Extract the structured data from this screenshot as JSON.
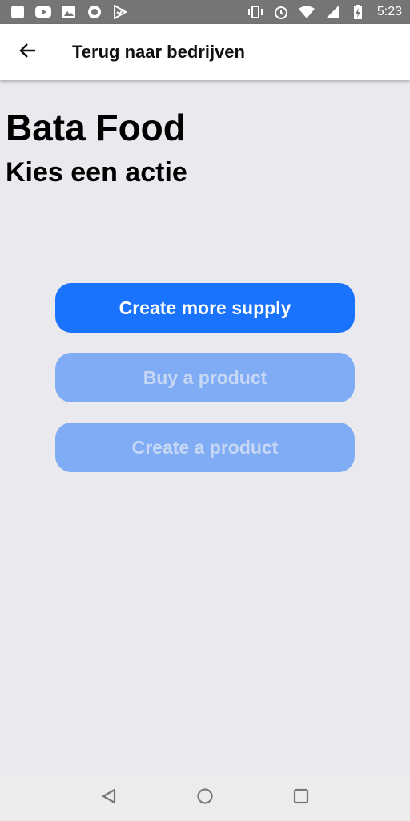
{
  "status_bar": {
    "time": "5:23",
    "left_icons": [
      "app-icon",
      "youtube-icon",
      "image-icon",
      "record-icon",
      "check-icon"
    ],
    "right_icons": [
      "vibrate-icon",
      "alarm-icon",
      "wifi-icon",
      "signal-icon",
      "battery-icon"
    ]
  },
  "app_bar": {
    "back_icon": "arrow-left-icon",
    "title": "Terug naar bedrijven"
  },
  "main": {
    "company_name": "Bata Food",
    "subtitle": "Kies een actie",
    "actions": [
      {
        "label": "Create more supply",
        "enabled": true
      },
      {
        "label": "Buy a product",
        "enabled": false
      },
      {
        "label": "Create a product",
        "enabled": false
      }
    ]
  },
  "nav_bar": {
    "icons": [
      "back-triangle-icon",
      "home-circle-icon",
      "recents-square-icon"
    ]
  },
  "colors": {
    "primary": "#1a73fc",
    "disabled_bg": "#80abf5",
    "disabled_text": "#c7d8f5",
    "background": "#e9e9ee"
  }
}
